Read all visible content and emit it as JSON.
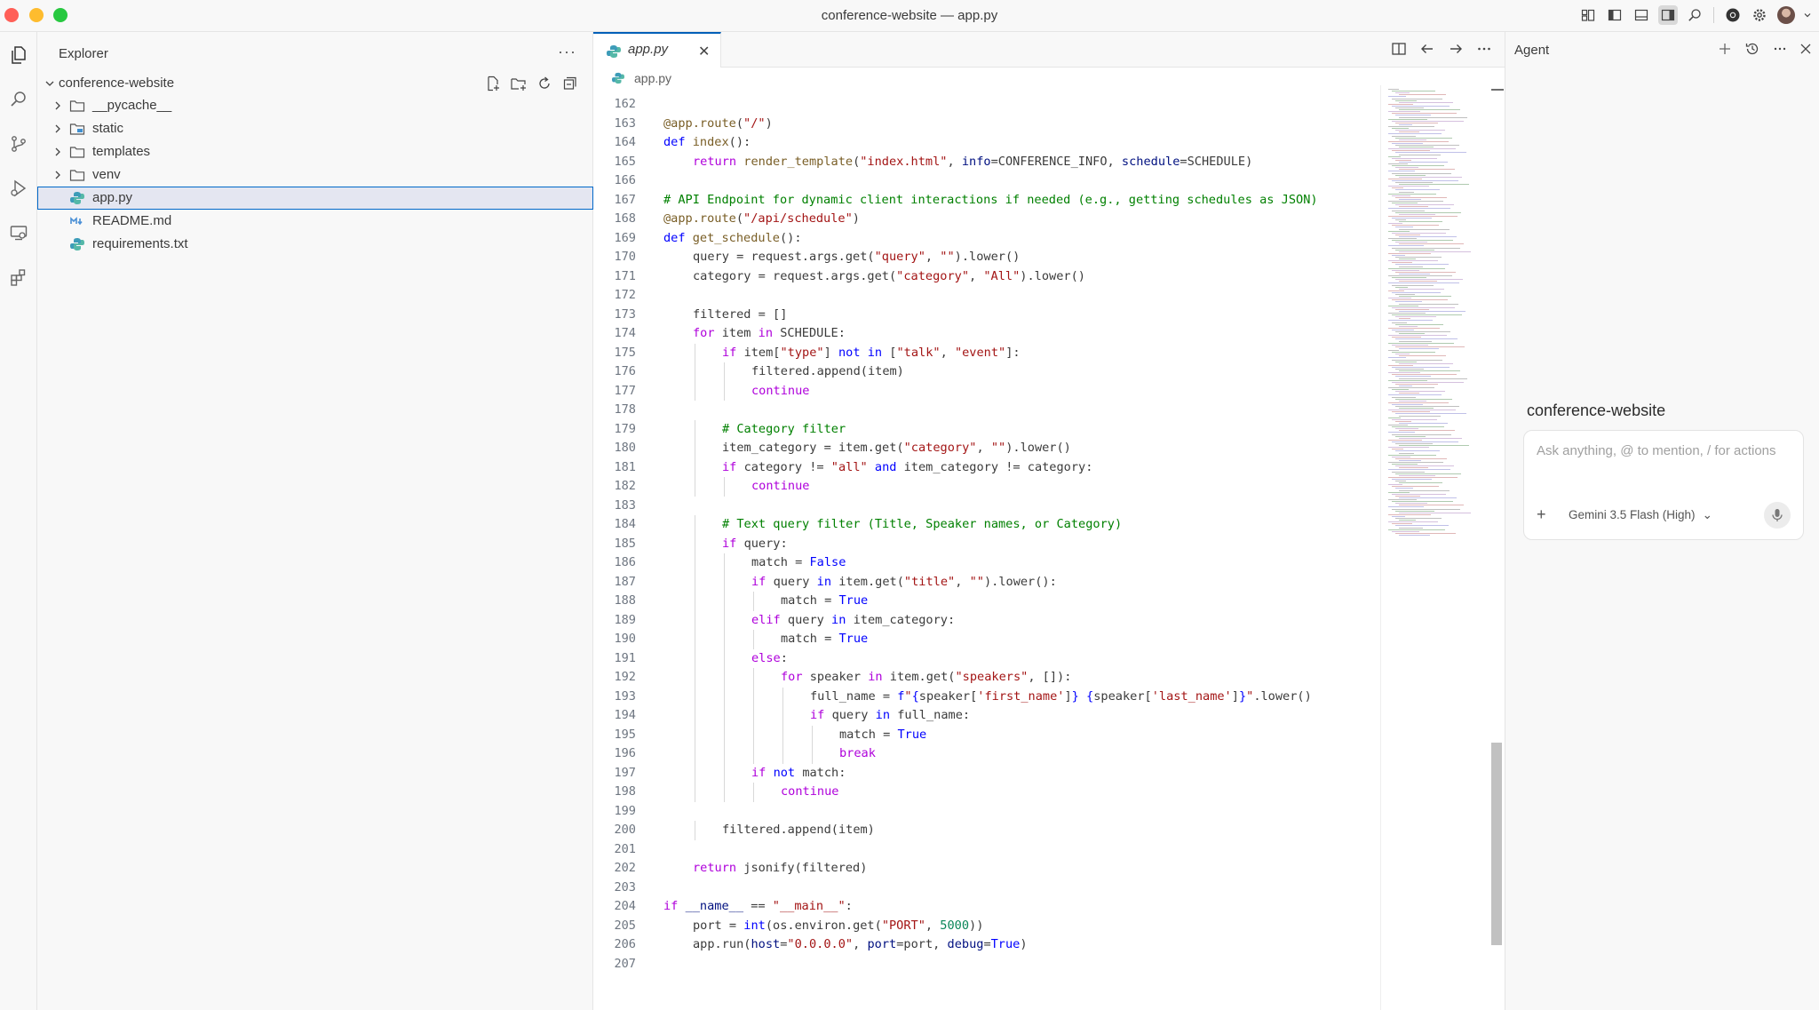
{
  "window": {
    "title": "conference-website — app.py"
  },
  "explorer": {
    "title": "Explorer",
    "root": "conference-website",
    "items": [
      {
        "label": "__pycache__",
        "kind": "folder"
      },
      {
        "label": "static",
        "kind": "folder"
      },
      {
        "label": "templates",
        "kind": "folder"
      },
      {
        "label": "venv",
        "kind": "folder"
      },
      {
        "label": "app.py",
        "kind": "python",
        "selected": true
      },
      {
        "label": "README.md",
        "kind": "markdown"
      },
      {
        "label": "requirements.txt",
        "kind": "python"
      }
    ]
  },
  "editor": {
    "tab_label": "app.py",
    "breadcrumb": "app.py",
    "lines": [
      {
        "n": "162",
        "indent": 0,
        "tokens": []
      },
      {
        "n": "163",
        "indent": 0,
        "tokens": [
          [
            "fn",
            "@app.route"
          ],
          [
            "",
            "("
          ],
          [
            "str",
            "\"/\""
          ],
          [
            "",
            ")"
          ]
        ]
      },
      {
        "n": "164",
        "indent": 0,
        "tokens": [
          [
            "kw",
            "def "
          ],
          [
            "fn",
            "index"
          ],
          [
            "",
            "():"
          ]
        ]
      },
      {
        "n": "165",
        "indent": 1,
        "tokens": [
          [
            "ctl",
            "return "
          ],
          [
            "fn",
            "render_template"
          ],
          [
            "",
            "("
          ],
          [
            "str",
            "\"index.html\""
          ],
          [
            "",
            ", "
          ],
          [
            "prm",
            "info"
          ],
          [
            "",
            "=CONFERENCE_INFO, "
          ],
          [
            "prm",
            "schedule"
          ],
          [
            "",
            "=SCHEDULE)"
          ]
        ]
      },
      {
        "n": "166",
        "indent": 0,
        "tokens": []
      },
      {
        "n": "167",
        "indent": 0,
        "tokens": [
          [
            "cm",
            "# API Endpoint for dynamic client interactions if needed (e.g., getting schedules as JSON)"
          ]
        ]
      },
      {
        "n": "168",
        "indent": 0,
        "tokens": [
          [
            "fn",
            "@app.route"
          ],
          [
            "",
            "("
          ],
          [
            "str",
            "\"/api/schedule\""
          ],
          [
            "",
            ")"
          ]
        ]
      },
      {
        "n": "169",
        "indent": 0,
        "tokens": [
          [
            "kw",
            "def "
          ],
          [
            "fn",
            "get_schedule"
          ],
          [
            "",
            "():"
          ]
        ]
      },
      {
        "n": "170",
        "indent": 1,
        "tokens": [
          [
            "",
            "query = request.args.get("
          ],
          [
            "str",
            "\"query\""
          ],
          [
            "",
            ", "
          ],
          [
            "str",
            "\"\""
          ],
          [
            "",
            ").lower()"
          ]
        ]
      },
      {
        "n": "171",
        "indent": 1,
        "tokens": [
          [
            "",
            "category = request.args.get("
          ],
          [
            "str",
            "\"category\""
          ],
          [
            "",
            ", "
          ],
          [
            "str",
            "\"All\""
          ],
          [
            "",
            ").lower()"
          ]
        ]
      },
      {
        "n": "172",
        "indent": 0,
        "tokens": []
      },
      {
        "n": "173",
        "indent": 1,
        "tokens": [
          [
            "",
            "filtered = []"
          ]
        ]
      },
      {
        "n": "174",
        "indent": 1,
        "tokens": [
          [
            "ctl",
            "for "
          ],
          [
            "",
            "item "
          ],
          [
            "ctl",
            "in "
          ],
          [
            "",
            "SCHEDULE:"
          ]
        ]
      },
      {
        "n": "175",
        "indent": 2,
        "tokens": [
          [
            "ctl",
            "if "
          ],
          [
            "",
            "item["
          ],
          [
            "str",
            "\"type\""
          ],
          [
            "",
            "] "
          ],
          [
            "kw",
            "not in "
          ],
          [
            "",
            "["
          ],
          [
            "str",
            "\"talk\""
          ],
          [
            "",
            ", "
          ],
          [
            "str",
            "\"event\""
          ],
          [
            "",
            "]:"
          ]
        ]
      },
      {
        "n": "176",
        "indent": 3,
        "tokens": [
          [
            "",
            "filtered.append(item)"
          ]
        ]
      },
      {
        "n": "177",
        "indent": 3,
        "tokens": [
          [
            "ctl",
            "continue"
          ]
        ]
      },
      {
        "n": "178",
        "indent": 0,
        "tokens": []
      },
      {
        "n": "179",
        "indent": 2,
        "tokens": [
          [
            "cm",
            "# Category filter"
          ]
        ]
      },
      {
        "n": "180",
        "indent": 2,
        "tokens": [
          [
            "",
            "item_category = item.get("
          ],
          [
            "str",
            "\"category\""
          ],
          [
            "",
            ", "
          ],
          [
            "str",
            "\"\""
          ],
          [
            "",
            ").lower()"
          ]
        ]
      },
      {
        "n": "181",
        "indent": 2,
        "tokens": [
          [
            "ctl",
            "if "
          ],
          [
            "",
            "category != "
          ],
          [
            "str",
            "\"all\""
          ],
          [
            "kw",
            " and "
          ],
          [
            "",
            "item_category != category:"
          ]
        ]
      },
      {
        "n": "182",
        "indent": 3,
        "tokens": [
          [
            "ctl",
            "continue"
          ]
        ]
      },
      {
        "n": "183",
        "indent": 0,
        "tokens": []
      },
      {
        "n": "184",
        "indent": 2,
        "tokens": [
          [
            "cm",
            "# Text query filter (Title, Speaker names, or Category)"
          ]
        ]
      },
      {
        "n": "185",
        "indent": 2,
        "tokens": [
          [
            "ctl",
            "if "
          ],
          [
            "",
            "query:"
          ]
        ]
      },
      {
        "n": "186",
        "indent": 3,
        "tokens": [
          [
            "",
            "match = "
          ],
          [
            "kw",
            "False"
          ]
        ]
      },
      {
        "n": "187",
        "indent": 3,
        "tokens": [
          [
            "ctl",
            "if "
          ],
          [
            "",
            "query "
          ],
          [
            "kw",
            "in "
          ],
          [
            "",
            "item.get("
          ],
          [
            "str",
            "\"title\""
          ],
          [
            "",
            ", "
          ],
          [
            "str",
            "\"\""
          ],
          [
            "",
            ").lower():"
          ]
        ]
      },
      {
        "n": "188",
        "indent": 4,
        "tokens": [
          [
            "",
            "match = "
          ],
          [
            "kw",
            "True"
          ]
        ]
      },
      {
        "n": "189",
        "indent": 3,
        "tokens": [
          [
            "ctl",
            "elif "
          ],
          [
            "",
            "query "
          ],
          [
            "kw",
            "in "
          ],
          [
            "",
            "item_category:"
          ]
        ]
      },
      {
        "n": "190",
        "indent": 4,
        "tokens": [
          [
            "",
            "match = "
          ],
          [
            "kw",
            "True"
          ]
        ]
      },
      {
        "n": "191",
        "indent": 3,
        "tokens": [
          [
            "ctl",
            "else"
          ],
          [
            "",
            ":"
          ]
        ]
      },
      {
        "n": "192",
        "indent": 4,
        "tokens": [
          [
            "ctl",
            "for "
          ],
          [
            "",
            "speaker "
          ],
          [
            "ctl",
            "in "
          ],
          [
            "",
            "item.get("
          ],
          [
            "str",
            "\"speakers\""
          ],
          [
            "",
            ", []):"
          ]
        ]
      },
      {
        "n": "193",
        "indent": 5,
        "tokens": [
          [
            "",
            "full_name = "
          ],
          [
            "kw",
            "f"
          ],
          [
            "str",
            "\""
          ],
          [
            "kw",
            "{"
          ],
          [
            "",
            "speaker["
          ],
          [
            "str",
            "'first_name'"
          ],
          [
            "",
            "]"
          ],
          [
            "kw",
            "}"
          ],
          [
            "str",
            " "
          ],
          [
            "kw",
            "{"
          ],
          [
            "",
            "speaker["
          ],
          [
            "str",
            "'last_name'"
          ],
          [
            "",
            "]"
          ],
          [
            "kw",
            "}"
          ],
          [
            "str",
            "\""
          ],
          [
            "",
            ".lower()"
          ]
        ]
      },
      {
        "n": "194",
        "indent": 5,
        "tokens": [
          [
            "ctl",
            "if "
          ],
          [
            "",
            "query "
          ],
          [
            "kw",
            "in "
          ],
          [
            "",
            "full_name:"
          ]
        ]
      },
      {
        "n": "195",
        "indent": 6,
        "tokens": [
          [
            "",
            "match = "
          ],
          [
            "kw",
            "True"
          ]
        ]
      },
      {
        "n": "196",
        "indent": 6,
        "tokens": [
          [
            "ctl",
            "break"
          ]
        ]
      },
      {
        "n": "197",
        "indent": 3,
        "tokens": [
          [
            "ctl",
            "if "
          ],
          [
            "kw",
            "not "
          ],
          [
            "",
            "match:"
          ]
        ]
      },
      {
        "n": "198",
        "indent": 4,
        "tokens": [
          [
            "ctl",
            "continue"
          ]
        ]
      },
      {
        "n": "199",
        "indent": 0,
        "tokens": []
      },
      {
        "n": "200",
        "indent": 2,
        "tokens": [
          [
            "",
            "filtered.append(item)"
          ]
        ]
      },
      {
        "n": "201",
        "indent": 0,
        "tokens": []
      },
      {
        "n": "202",
        "indent": 1,
        "tokens": [
          [
            "ctl",
            "return "
          ],
          [
            "",
            "jsonify(filtered)"
          ]
        ]
      },
      {
        "n": "203",
        "indent": 0,
        "tokens": []
      },
      {
        "n": "204",
        "indent": 0,
        "tokens": [
          [
            "ctl",
            "if "
          ],
          [
            "prm",
            "__name__"
          ],
          [
            "",
            " == "
          ],
          [
            "str",
            "\"__main__\""
          ],
          [
            "",
            ":"
          ]
        ]
      },
      {
        "n": "205",
        "indent": 1,
        "tokens": [
          [
            "",
            "port = "
          ],
          [
            "kw",
            "int"
          ],
          [
            "",
            "(os.environ.get("
          ],
          [
            "str",
            "\"PORT\""
          ],
          [
            "",
            ", "
          ],
          [
            "num",
            "5000"
          ],
          [
            "",
            "))"
          ]
        ]
      },
      {
        "n": "206",
        "indent": 1,
        "tokens": [
          [
            "",
            "app.run("
          ],
          [
            "prm",
            "host"
          ],
          [
            "",
            "="
          ],
          [
            "str",
            "\"0.0.0.0\""
          ],
          [
            "",
            ", "
          ],
          [
            "prm",
            "port"
          ],
          [
            "",
            "=port, "
          ],
          [
            "prm",
            "debug"
          ],
          [
            "",
            "="
          ],
          [
            "kw",
            "True"
          ],
          [
            "",
            ")"
          ]
        ]
      },
      {
        "n": "207",
        "indent": 0,
        "tokens": []
      }
    ]
  },
  "agent": {
    "title": "Agent",
    "workspace": "conference-website",
    "input_placeholder": "Ask anything, @ to mention, / for actions",
    "model": "Gemini 3.5 Flash (High)"
  },
  "colors": {
    "accent": "#005fb8",
    "selection": "#e4e6f1",
    "keyword": "#0000ff",
    "control": "#af00db",
    "string": "#a31515",
    "comment": "#008000"
  }
}
